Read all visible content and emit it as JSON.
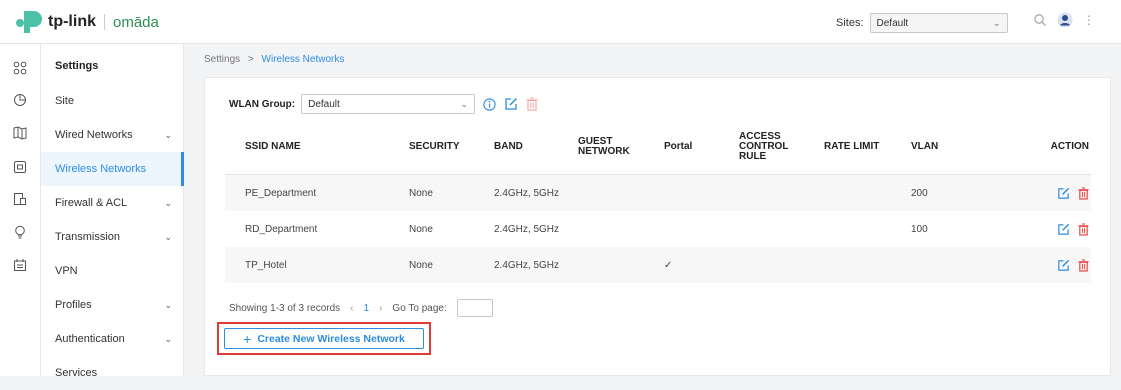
{
  "brand": {
    "tp_link": "tp-link",
    "omada": "omāda",
    "brand_color": "#4cc1a6"
  },
  "topbar": {
    "sites_label": "Sites:",
    "sites_value": "Default"
  },
  "sidenav": {
    "title": "Settings",
    "items": [
      {
        "label": "Site",
        "has_children": false
      },
      {
        "label": "Wired Networks",
        "has_children": true
      },
      {
        "label": "Wireless Networks",
        "has_children": false,
        "active": true
      },
      {
        "label": "Firewall & ACL",
        "has_children": true
      },
      {
        "label": "Transmission",
        "has_children": true
      },
      {
        "label": "VPN",
        "has_children": false
      },
      {
        "label": "Profiles",
        "has_children": true
      },
      {
        "label": "Authentication",
        "has_children": true
      },
      {
        "label": "Services",
        "has_children": false
      }
    ]
  },
  "breadcrumb": {
    "root": "Settings",
    "separator": ">",
    "current": "Wireless Networks"
  },
  "wlan": {
    "label": "WLAN Group:",
    "value": "Default"
  },
  "table": {
    "headers": [
      "SSID NAME",
      "SECURITY",
      "BAND",
      "GUEST NETWORK",
      "Portal",
      "ACCESS CONTROL RULE",
      "RATE LIMIT",
      "VLAN",
      "ACTION"
    ],
    "rows": [
      {
        "ssid": "PE_Department",
        "security": "None",
        "band": "2.4GHz, 5GHz",
        "guest": "",
        "portal": "",
        "acl": "",
        "rate": "",
        "vlan": "200"
      },
      {
        "ssid": "RD_Department",
        "security": "None",
        "band": "2.4GHz, 5GHz",
        "guest": "",
        "portal": "",
        "acl": "",
        "rate": "",
        "vlan": "100"
      },
      {
        "ssid": "TP_Hotel",
        "security": "None",
        "band": "2.4GHz, 5GHz",
        "guest": "",
        "portal": "✓",
        "acl": "",
        "rate": "",
        "vlan": ""
      }
    ]
  },
  "pagination": {
    "summary": "Showing 1-3 of 3 records",
    "page": "1",
    "goto_label": "Go To page:"
  },
  "create_button": {
    "label": "Create New Wireless Network"
  },
  "colors": {
    "accent": "#2d8ce3",
    "danger": "#e53935",
    "highlight_box": "#e53935"
  }
}
